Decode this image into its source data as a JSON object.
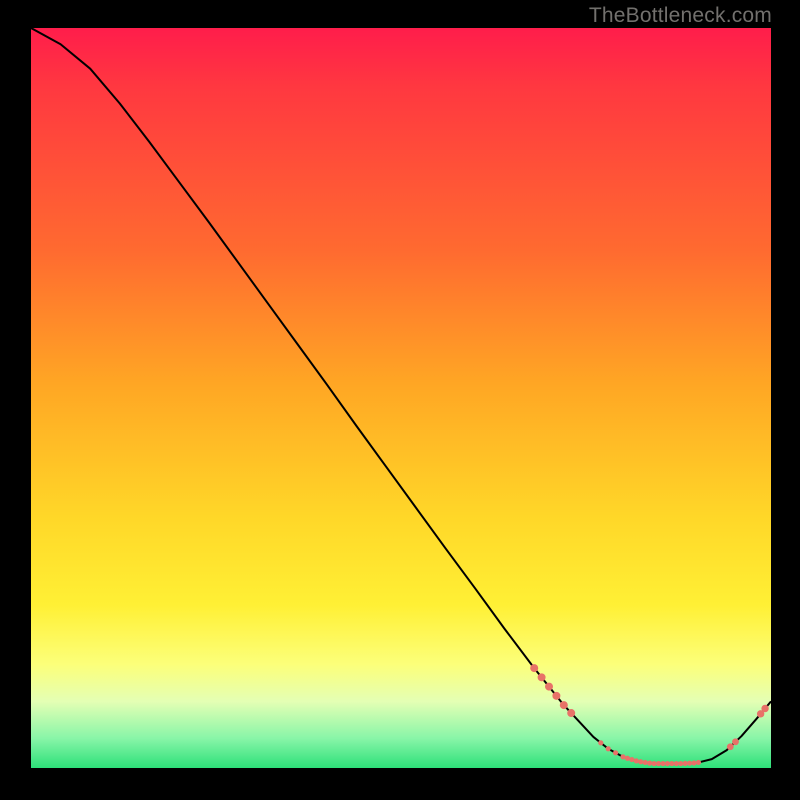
{
  "watermark": "TheBottleneck.com",
  "colors": {
    "background": "#000000",
    "line": "#000000",
    "marker": "#e87268",
    "gradient_top": "#ff1d4b",
    "gradient_bottom": "#2de079"
  },
  "chart_data": {
    "type": "line",
    "title": "",
    "xlabel": "",
    "ylabel": "",
    "xlim": [
      0,
      100
    ],
    "ylim": [
      0,
      100
    ],
    "series": [
      {
        "name": "curve",
        "x": [
          0,
          4,
          8,
          12,
          16,
          20,
          24,
          28,
          32,
          36,
          40,
          44,
          48,
          52,
          56,
          60,
          64,
          68,
          72,
          76,
          78,
          80,
          82,
          84,
          86,
          88,
          90,
          92,
          94,
          96,
          98,
          100
        ],
        "y": [
          100,
          97.8,
          94.5,
          89.8,
          84.6,
          79.2,
          73.8,
          68.3,
          62.8,
          57.3,
          51.8,
          46.2,
          40.7,
          35.2,
          29.7,
          24.3,
          18.8,
          13.5,
          8.5,
          4.2,
          2.6,
          1.5,
          0.9,
          0.6,
          0.6,
          0.6,
          0.7,
          1.2,
          2.4,
          4.3,
          6.6,
          9.0
        ]
      }
    ],
    "markers_x": [
      68,
      69,
      70,
      71,
      72,
      73,
      77,
      78,
      79,
      80,
      80.6,
      81.2,
      81.8,
      82.4,
      83,
      83.6,
      84.2,
      84.8,
      85.4,
      86,
      86.6,
      87.2,
      87.8,
      88.4,
      89,
      89.6,
      90.2,
      94.5,
      95.2,
      98.6,
      99.2
    ],
    "marker_radius_range": [
      2.2,
      4.0
    ]
  }
}
